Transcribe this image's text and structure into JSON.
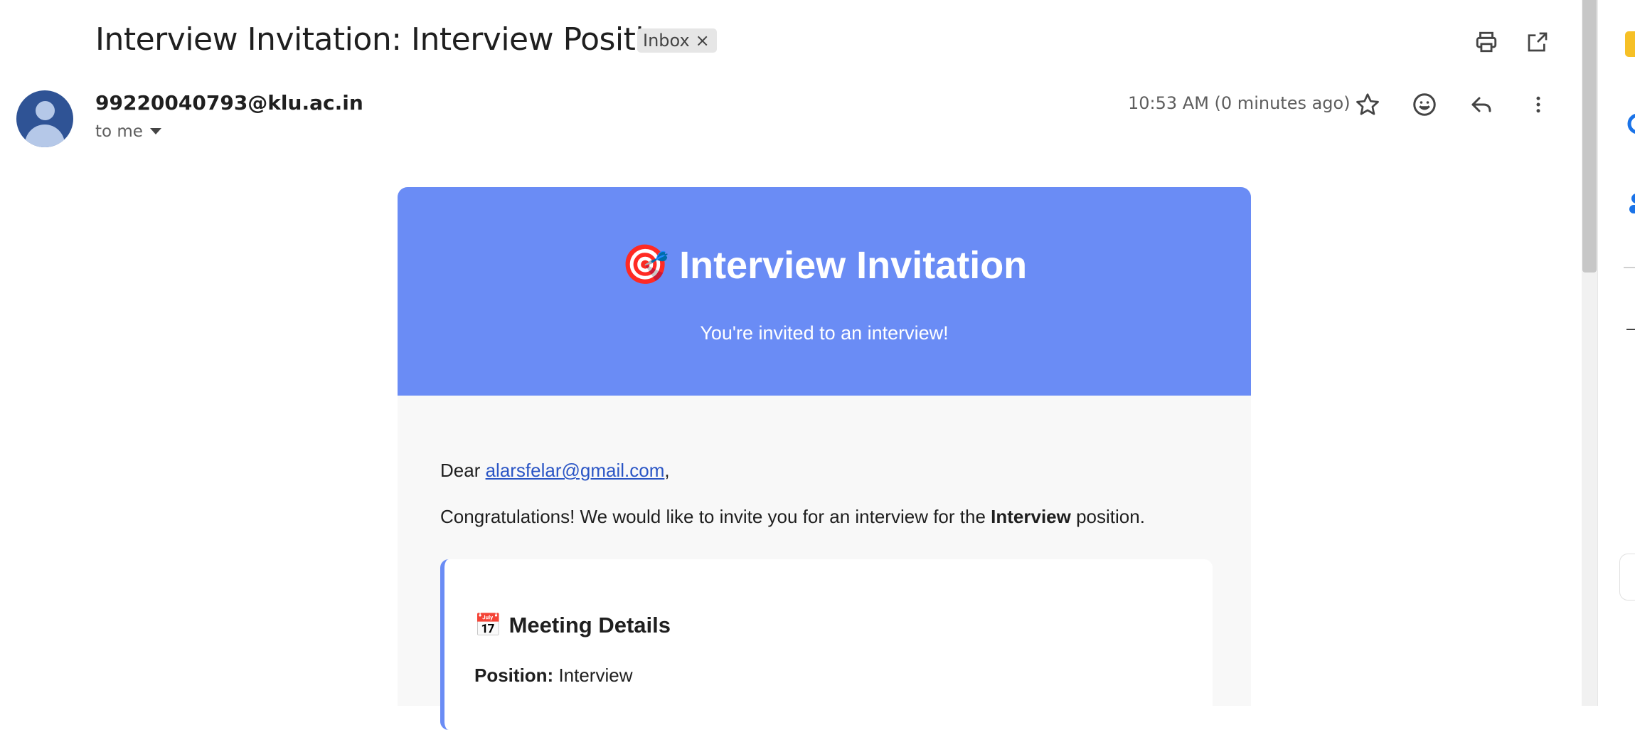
{
  "header": {
    "subject": "Interview Invitation: Interview Position",
    "label_chip": "Inbox",
    "label_remove": "×"
  },
  "toolbar": {
    "print_icon": "print-icon",
    "open_new_window_icon": "open-in-new-icon"
  },
  "message": {
    "sender": "99220040793@klu.ac.in",
    "recipient_text": "to me",
    "timestamp": "10:53 AM (0 minutes ago)",
    "actions": [
      "star-icon",
      "emoji-icon",
      "reply-icon",
      "more-vert-icon"
    ]
  },
  "email_body": {
    "banner_icon": "🎯",
    "banner_title": "Interview Invitation",
    "banner_subtitle": "You're invited to an interview!",
    "greeting_prefix": "Dear ",
    "greeting_email": "alarsfelar@gmail.com",
    "greeting_suffix": ",",
    "congrats_prefix": "Congratulations! We would like to invite you for an interview for the ",
    "congrats_bold": "Interview",
    "congrats_suffix": " position.",
    "details": {
      "icon": "📅",
      "title": "Meeting Details",
      "position_label": "Position:",
      "position_value": " Interview"
    }
  },
  "colors": {
    "banner": "#6a8cf5",
    "body_bg": "#f8f8f8",
    "link": "#2a55c5",
    "avatar": "#2f5395"
  }
}
